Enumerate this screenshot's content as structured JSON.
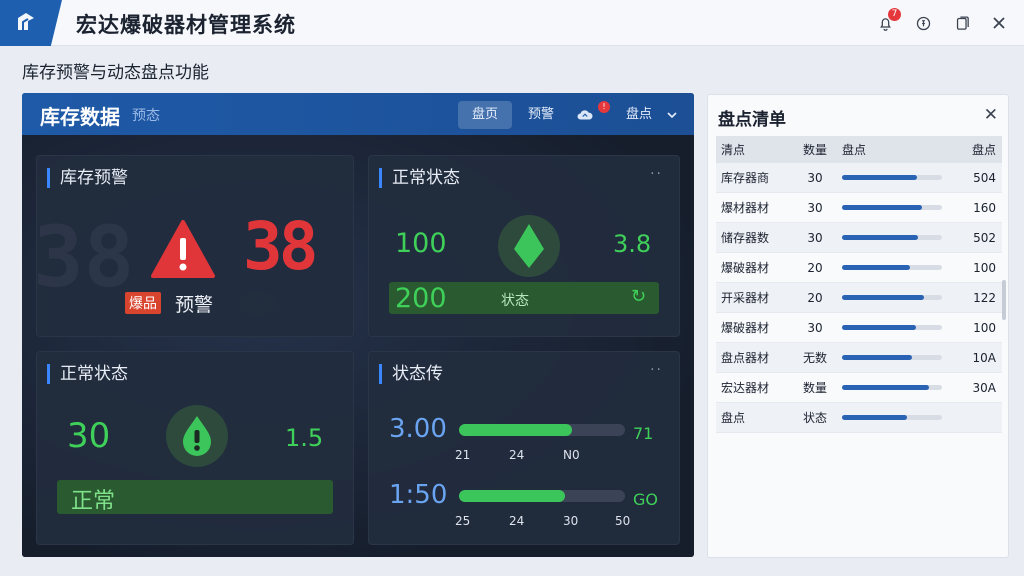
{
  "app": {
    "title": "宏达爆破器材管理系统",
    "notification_count": "7"
  },
  "section": {
    "title": "库存预警与动态盘点功能"
  },
  "dashboard": {
    "title": "库存数据",
    "subtitle": "预态",
    "tabs": [
      {
        "label": "盘页",
        "active": true
      },
      {
        "label": "预警",
        "active": false
      },
      {
        "label": "盘点",
        "active": false
      }
    ],
    "alert_badge": "!",
    "cards": {
      "warning": {
        "title": "库存预警",
        "count": "38",
        "tag": "爆品",
        "label": "预警"
      },
      "normal1": {
        "title": "正常状态",
        "value_left": "100",
        "value_right": "3.8",
        "value_bottom": "200",
        "pill_text": "状态",
        "pill_icon": "↻"
      },
      "normal2": {
        "title": "正常状态",
        "value_left": "30",
        "value_right": "1.5",
        "pill_text": "正常"
      },
      "status": {
        "title": "状态传",
        "rows": [
          {
            "value": "3.00",
            "tail": "71",
            "percent": 68,
            "ticks": [
              "21",
              "24",
              "N0"
            ]
          },
          {
            "value": "1:50",
            "tail": "GO",
            "percent": 64,
            "ticks": [
              "25",
              "24",
              "30",
              "50"
            ]
          }
        ]
      }
    }
  },
  "panel": {
    "title": "盘点清单",
    "headers": [
      "清点",
      "数量",
      "盘点",
      "盘点"
    ],
    "rows": [
      {
        "name": "库存器商",
        "qty": "30",
        "progress": 75,
        "value": "504"
      },
      {
        "name": "爆材器材",
        "qty": "30",
        "progress": 80,
        "value": "160"
      },
      {
        "name": "储存器数",
        "qty": "30",
        "progress": 76,
        "value": "502"
      },
      {
        "name": "爆破器材",
        "qty": "20",
        "progress": 68,
        "value": "100"
      },
      {
        "name": "开采器材",
        "qty": "20",
        "progress": 82,
        "value": "122"
      },
      {
        "name": "爆破器材",
        "qty": "30",
        "progress": 74,
        "value": "100"
      },
      {
        "name": "盘点器材",
        "qty": "无数",
        "progress": 70,
        "value": "10A"
      },
      {
        "name": "宏达器材",
        "qty": "数量",
        "progress": 87,
        "value": "30A"
      },
      {
        "name": "盘点",
        "qty": "状态",
        "progress": 65,
        "value": ""
      }
    ]
  },
  "colors": {
    "accent": "#1f5fb0",
    "green": "#3fd05a",
    "red": "#e4383c"
  }
}
